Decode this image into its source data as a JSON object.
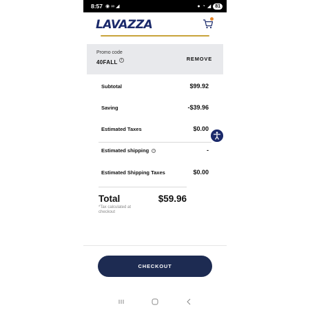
{
  "status_bar": {
    "time": "8:57",
    "battery": "81"
  },
  "header": {
    "logo_text": "LAVAZZA"
  },
  "promo": {
    "label": "Promo code",
    "code": "40FALL",
    "remove_label": "REMOVE"
  },
  "summary": {
    "rows": [
      {
        "label": "Subtotal",
        "value": "$99.92"
      },
      {
        "label": "Saving",
        "value": "-$39.96"
      },
      {
        "label": "Estimated Taxes",
        "value": "$0.00"
      },
      {
        "label": "Estimated shipping",
        "value": "-"
      },
      {
        "label": "Estimated Shipping Taxes",
        "value": "$0.00"
      }
    ],
    "total_label": "Total",
    "total_value": "$59.96",
    "tax_note": "*Tax calculated at checkout"
  },
  "checkout": {
    "button_label": "CHECKOUT"
  },
  "colors": {
    "brand_navy": "#1b2a6b",
    "checkout_navy": "#1d2b52",
    "accent_gold": "#c8a33a",
    "cart_badge": "#e5862b",
    "promo_bg": "#e8e9ec"
  },
  "icons": [
    "cart-icon",
    "info-icon",
    "accessibility-icon",
    "recent-apps-icon",
    "home-icon",
    "back-icon"
  ]
}
